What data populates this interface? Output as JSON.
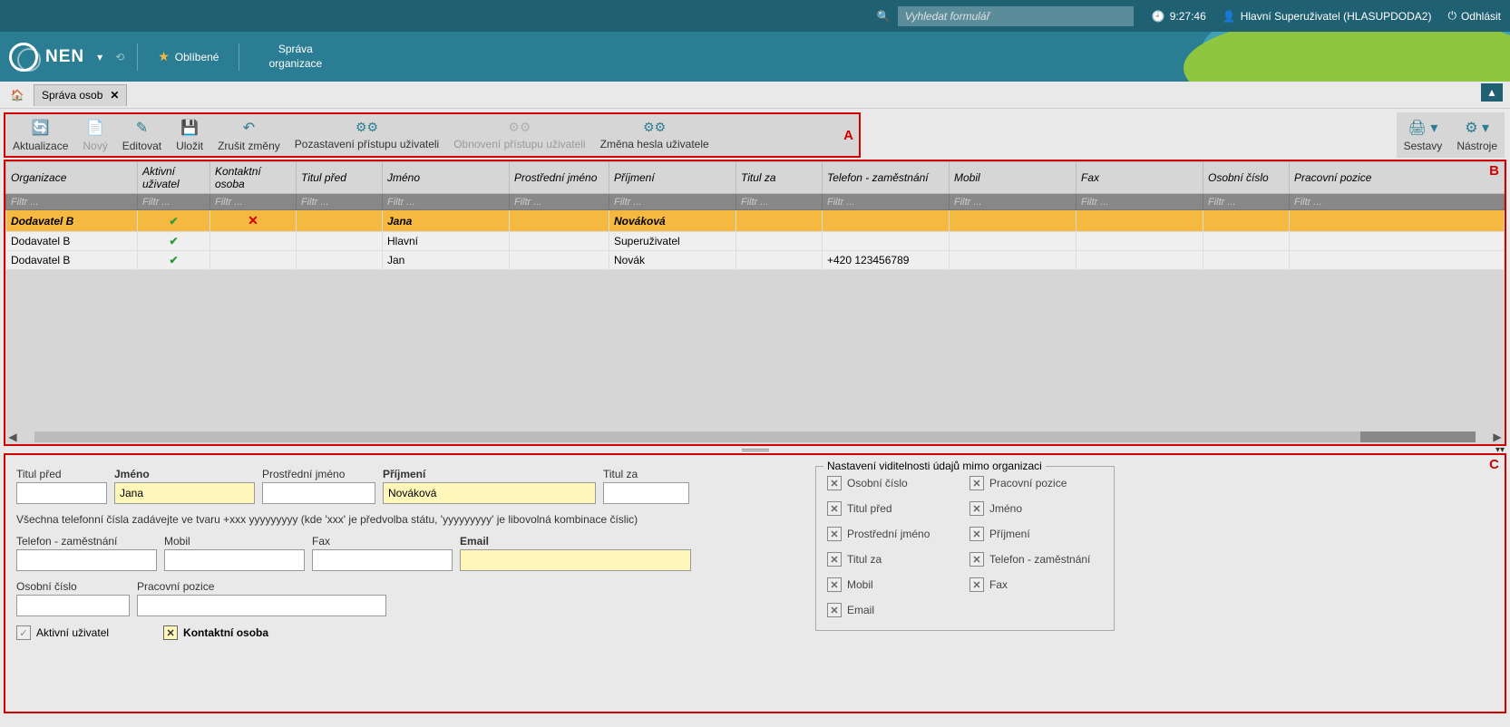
{
  "topbar": {
    "search_placeholder": "Vyhledat formulář",
    "time": "9:27:46",
    "user": "Hlavní Superuživatel (HLASUPDODA2)",
    "logout": "Odhlásit"
  },
  "menubar": {
    "logo": "NEN",
    "favorites": "Oblíbené",
    "org_mgmt_l1": "Správa",
    "org_mgmt_l2": "organizace"
  },
  "tabs": {
    "current": "Správa osob"
  },
  "toolbar": {
    "refresh": "Aktualizace",
    "new": "Nový",
    "edit": "Editovat",
    "save": "Uložit",
    "undo": "Zrušit změny",
    "suspend": "Pozastavení přístupu uživateli",
    "restore": "Obnovení přístupu uživateli",
    "chpass": "Změna hesla uživatele",
    "reports": "Sestavy",
    "tools": "Nástroje",
    "marker": "A"
  },
  "table": {
    "marker": "B",
    "filter_placeholder": "Filtr ...",
    "cols": {
      "org": "Organizace",
      "active": "Aktivní uživatel",
      "contact": "Kontaktní osoba",
      "title_before": "Titul před",
      "first": "Jméno",
      "middle": "Prostřední jméno",
      "last": "Příjmení",
      "title_after": "Titul za",
      "phone": "Telefon - zaměstnání",
      "mobile": "Mobil",
      "fax": "Fax",
      "empno": "Osobní číslo",
      "position": "Pracovní pozice"
    },
    "rows": [
      {
        "org": "Dodavatel B",
        "active": true,
        "contact": false,
        "title_before": "",
        "first": "Jana",
        "middle": "",
        "last": "Nováková",
        "title_after": "",
        "phone": "",
        "mobile": "",
        "fax": "",
        "empno": "",
        "position": "",
        "selected": true
      },
      {
        "org": "Dodavatel B",
        "active": true,
        "contact": null,
        "title_before": "",
        "first": "Hlavní",
        "middle": "",
        "last": "Superuživatel",
        "title_after": "",
        "phone": "",
        "mobile": "",
        "fax": "",
        "empno": "",
        "position": ""
      },
      {
        "org": "Dodavatel B",
        "active": true,
        "contact": null,
        "title_before": "",
        "first": "Jan",
        "middle": "",
        "last": "Novák",
        "title_after": "",
        "phone": "+420 123456789",
        "mobile": "",
        "fax": "",
        "empno": "",
        "position": ""
      }
    ]
  },
  "form": {
    "marker": "C",
    "labels": {
      "title_before": "Titul před",
      "first": "Jméno",
      "middle": "Prostřední jméno",
      "last": "Příjmení",
      "title_after": "Titul za",
      "note": "Všechna telefonní čísla zadávejte ve tvaru +xxx yyyyyyyyy (kde 'xxx' je předvolba státu, 'yyyyyyyyy' je libovolná kombinace číslic)",
      "phone": "Telefon - zaměstnání",
      "mobile": "Mobil",
      "fax": "Fax",
      "email": "Email",
      "empno": "Osobní číslo",
      "position": "Pracovní pozice",
      "active": "Aktivní uživatel",
      "contact": "Kontaktní osoba"
    },
    "values": {
      "title_before": "",
      "first": "Jana",
      "middle": "",
      "last": "Nováková",
      "title_after": "",
      "phone": "",
      "mobile": "",
      "fax": "",
      "email": "",
      "empno": "",
      "position": ""
    },
    "visibility": {
      "legend": "Nastavení viditelnosti údajů mimo organizaci",
      "items": [
        "Osobní číslo",
        "Pracovní pozice",
        "Titul před",
        "Jméno",
        "Prostřední jméno",
        "Příjmení",
        "Titul za",
        "Telefon - zaměstnání",
        "Mobil",
        "Fax",
        "Email"
      ]
    }
  }
}
